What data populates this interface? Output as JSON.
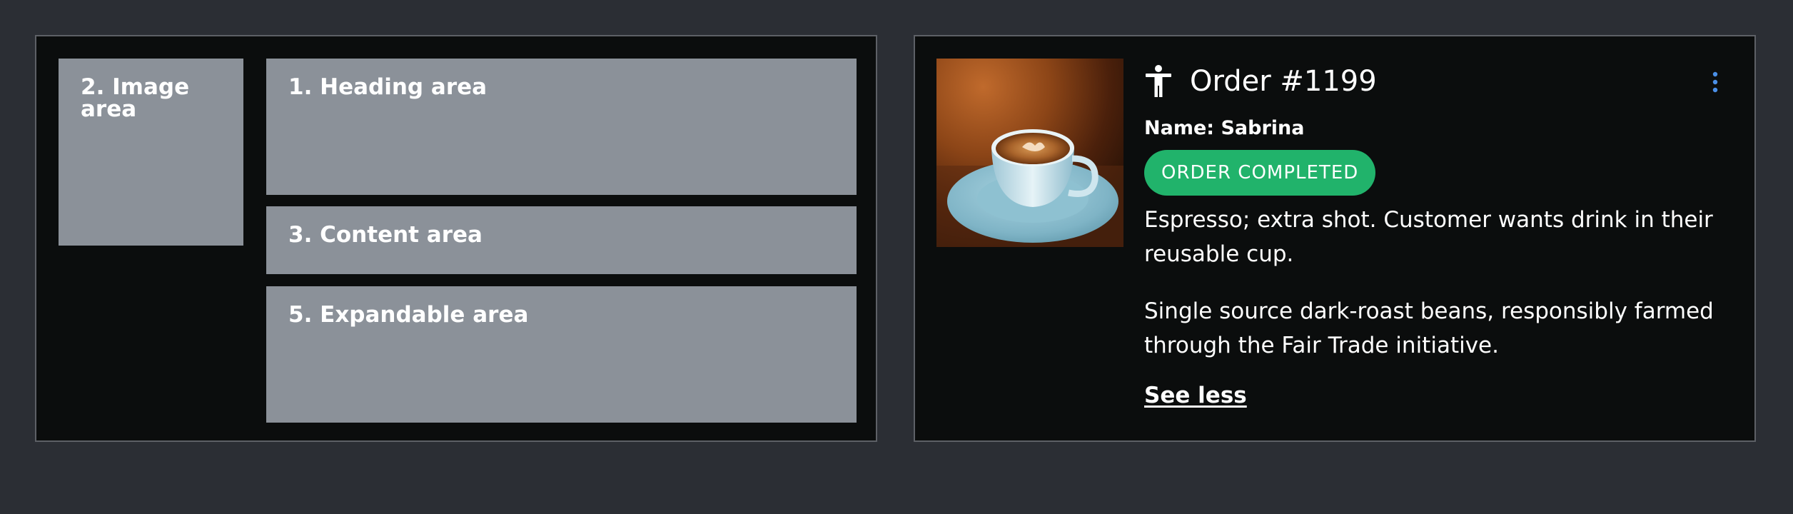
{
  "layout_diagram": {
    "image_area_label": "2. Image area",
    "heading_area_label": "1. Heading area",
    "content_area_label": "3. Content area",
    "expandable_area_label": "5. Expandable area"
  },
  "order_card": {
    "title": "Order #1199",
    "name_line": "Name: Sabrina",
    "status_badge": "ORDER COMPLETED",
    "description_1": "Espresso; extra shot. Customer wants drink in their reusable cup.",
    "description_2": "Single source dark-roast beans, responsibly farmed through the Fair Trade initiative.",
    "toggle_link": "See less",
    "icons": {
      "title_icon": "accessibility-icon",
      "menu_icon": "more-vertical-icon",
      "photo": "espresso-cup-photo"
    }
  },
  "colors": {
    "page_background": "#2b2e34",
    "card_background": "#0b0d0d",
    "card_border": "#5d6066",
    "area_fill": "#8b9199",
    "badge_green": "#21b36b",
    "menu_accent": "#4a8fe7"
  }
}
